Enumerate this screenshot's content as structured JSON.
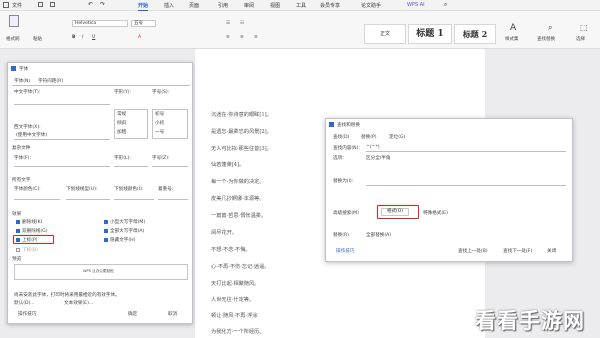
{
  "menubar": {
    "items": [
      "文件",
      "开始",
      "插入",
      "页面",
      "引用",
      "审阅",
      "视图",
      "工具",
      "会员专享",
      "论文助手"
    ],
    "active_index": 1,
    "ai_label": "WPS AI"
  },
  "ribbon": {
    "font_name": "Helvetica",
    "font_size": "五号",
    "format_painter": "格式刷",
    "paste": "粘贴",
    "styles": [
      "正文",
      "标题 1",
      "标题 2"
    ],
    "style_set": "样式集",
    "find_replace": "查找替换",
    "select": "选择"
  },
  "font_dialog": {
    "title": "字体",
    "tabs": [
      "字体(N)",
      "字符间距(R)"
    ],
    "chinese_font_label": "中文字体(T):",
    "style_label": "字形(Y):",
    "size_label": "字号(S):",
    "style_options": [
      "常规",
      "倾斜",
      "加粗"
    ],
    "size_options": [
      "初号",
      "小初",
      "一号"
    ],
    "western_font_label": "西文字体(X):",
    "western_font_value": "(使用中文字体)",
    "complex_section": "复杂文种",
    "complex_font_label": "字体(F):",
    "complex_style_label": "字形(L):",
    "complex_size_label": "字号(Z):",
    "all_text_section": "所有文字",
    "font_color_label": "字体颜色(C):",
    "underline_type_label": "下划线线型(U):",
    "underline_color_label": "下划线颜色(I):",
    "emphasis_label": "着重号:",
    "effects_section": "效果",
    "effects_left": [
      "删除线(K)",
      "双删除线(G)",
      "上标(P)",
      "下标(B)"
    ],
    "effects_right": [
      "小型大写字母(M)",
      "全部大写字母(A)",
      "隐藏文字(H)"
    ],
    "preview_section": "预览",
    "preview_text": "WPS 让办公更轻松",
    "note_text": "尚未安装此字体，打印时将采用最相近的有效字体。",
    "default_btn": "默认(D)...",
    "text_effects_btn": "文本效果(E)...",
    "tips_btn": "操作技巧",
    "ok_btn": "确定",
    "cancel_btn": "取消"
  },
  "find_dialog": {
    "title": "查找和替换",
    "tabs": [
      "查找(D)",
      "替换(P)",
      "定位(G)"
    ],
    "find_label": "查找内容(N):",
    "find_value": "^(^*)",
    "options_label": "选项:",
    "options_value": "区分全/半角",
    "replace_label": "替换为(I):",
    "replace_value": "",
    "advanced_btn": "高级搜索(M)",
    "format_btn": "格式(O)",
    "special_btn": "特殊格式(E)",
    "replace_btn": "替换(R)",
    "replace_all_btn": "全部替换(A)",
    "find_prev_btn": "查找上一处(B)",
    "find_next_btn": "查找下一处(F)",
    "close_btn": "关闭",
    "tips_btn": "操作技巧"
  },
  "document": {
    "lines": [
      "沉迷在·你诗意的眼眸[1]。",
      "是遗忘·最柔忘的风景[2]。",
      "无人可比拟·那些往昔[3]。",
      "仙若蓬萊[4]。",
      "每一个·为你做的决定。",
      "皮美几抄婀娜·本源等。",
      "一篇篇·哲思·惆怅温柔。",
      "阅尽花开。",
      "不想·不念·不悔。",
      "心·不再·不伤·忘记·逍遥。",
      "天打比起·相聚随风。",
      "人世无往·什定等。",
      "顿让·随风·不再·浮涂",
      "为我化方·一个所经历。"
    ]
  },
  "watermark": "看看手游网"
}
